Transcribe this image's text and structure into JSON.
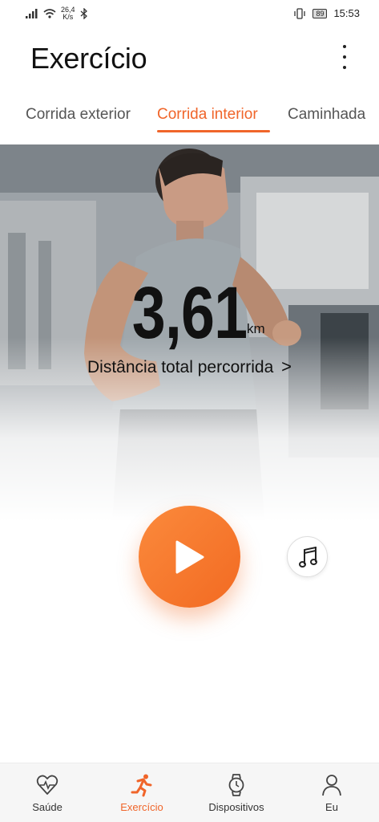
{
  "status_bar": {
    "speed_value": "26,4",
    "speed_unit": "K/s",
    "battery": "89",
    "time": "15:53"
  },
  "header": {
    "title": "Exercício",
    "menu_icon": "more-vertical-icon"
  },
  "tabs": [
    {
      "label": "Corrida exterior",
      "active": false
    },
    {
      "label": "Corrida interior",
      "active": true
    },
    {
      "label": "Caminhada",
      "active": false
    }
  ],
  "summary": {
    "distance_value": "3,61",
    "distance_unit": "km",
    "distance_label": "Distância total percorrida",
    "chevron": ">"
  },
  "controls": {
    "play_icon": "play-icon",
    "music_icon": "music-note-icon"
  },
  "bottom_nav": [
    {
      "label": "Saúde",
      "icon": "heart-pulse-icon",
      "active": false
    },
    {
      "label": "Exercício",
      "icon": "running-icon",
      "active": true
    },
    {
      "label": "Dispositivos",
      "icon": "watch-icon",
      "active": false
    },
    {
      "label": "Eu",
      "icon": "person-icon",
      "active": false
    }
  ],
  "colors": {
    "accent": "#f0652a",
    "text": "#111111",
    "nav_bg": "#f6f6f6"
  }
}
